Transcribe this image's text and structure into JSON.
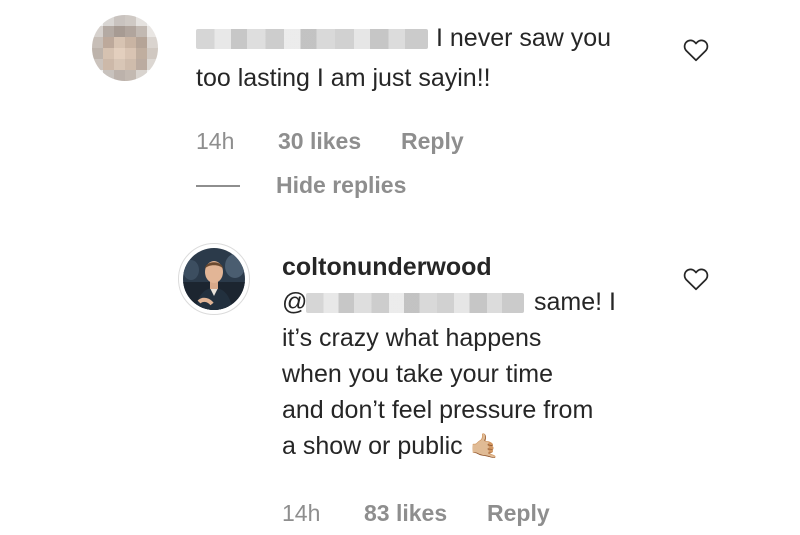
{
  "comment1": {
    "text_line1": "I never saw you",
    "text_line2": "too lasting I am just sayin!!",
    "time": "14h",
    "likes": "30 likes",
    "reply": "Reply"
  },
  "hide_replies": "Hide replies",
  "reply1": {
    "username": "coltonunderwood",
    "mention_prefix": "@",
    "line1_tail": "same! I",
    "line2": "it’s crazy what happens",
    "line3": "when you take your time",
    "line4": "and don’t feel pressure from",
    "line5": "a show or public",
    "emoji": "🤙🏼",
    "time": "14h",
    "likes": "83 likes",
    "reply": "Reply"
  },
  "icons": {
    "like": "heart-outline-icon"
  }
}
